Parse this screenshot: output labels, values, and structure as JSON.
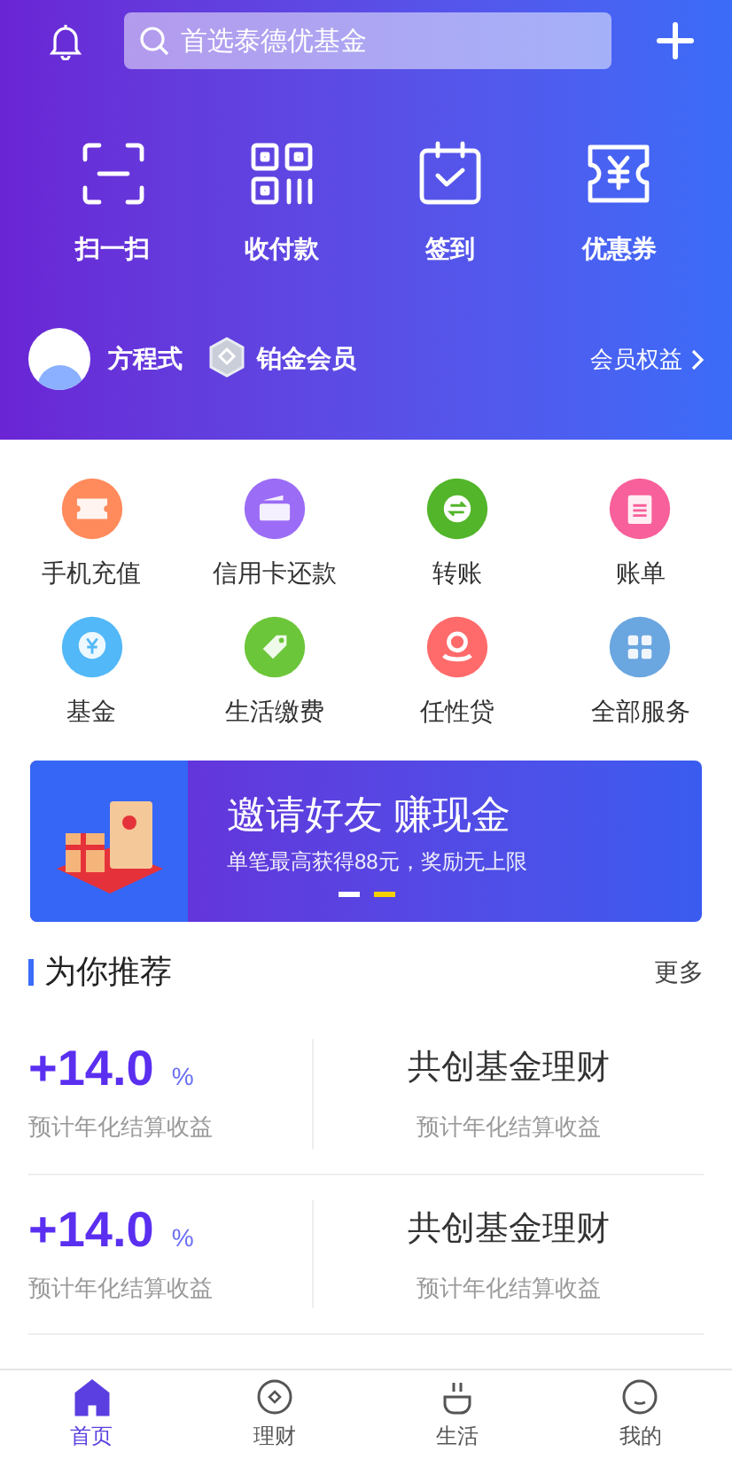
{
  "header": {
    "search": {
      "placeholder": "首选泰德优基金"
    },
    "quick_actions": [
      {
        "kind": "scan",
        "label": "扫一扫"
      },
      {
        "kind": "qr",
        "label": "收付款"
      },
      {
        "kind": "checkin",
        "label": "签到"
      },
      {
        "kind": "coupon",
        "label": "优惠券"
      }
    ],
    "user": {
      "name": "方程式",
      "tier": "铂金会员",
      "benefits_link": "会员权益"
    }
  },
  "services": [
    {
      "kind": "ticket",
      "label": "手机充值",
      "color": "#ff8a5c"
    },
    {
      "kind": "card",
      "label": "信用卡还款",
      "color": "#9b6cf5"
    },
    {
      "kind": "transfer",
      "label": "转账",
      "color": "#52b52a"
    },
    {
      "kind": "bill",
      "label": "账单",
      "color": "#f7609a"
    },
    {
      "kind": "fund",
      "label": "基金",
      "color": "#52b8f7"
    },
    {
      "kind": "tag",
      "label": "生活缴费",
      "color": "#6cc63a"
    },
    {
      "kind": "loan",
      "label": "任性贷",
      "color": "#ff6b6b"
    },
    {
      "kind": "grid",
      "label": "全部服务",
      "color": "#6aa6e0"
    }
  ],
  "banner": {
    "title": "邀请好友 赚现金",
    "subtitle": "单笔最高获得88元，奖励无上限",
    "dots": [
      {
        "selected": false
      },
      {
        "selected": true
      }
    ]
  },
  "recommend": {
    "title": "为你推荐",
    "more": "更多",
    "items": [
      {
        "rate": "+14.0",
        "unit": "%",
        "rate_caption": "预计年化结算收益",
        "name": "共创基金理财",
        "name_caption": "预计年化结算收益"
      },
      {
        "rate": "+14.0",
        "unit": "%",
        "rate_caption": "预计年化结算收益",
        "name": "共创基金理财",
        "name_caption": "预计年化结算收益"
      }
    ]
  },
  "tab_bar": [
    {
      "kind": "home",
      "label": "首页",
      "selected": true
    },
    {
      "kind": "finance",
      "label": "理财",
      "selected": false
    },
    {
      "kind": "life",
      "label": "生活",
      "selected": false
    },
    {
      "kind": "me",
      "label": "我的",
      "selected": false
    }
  ]
}
